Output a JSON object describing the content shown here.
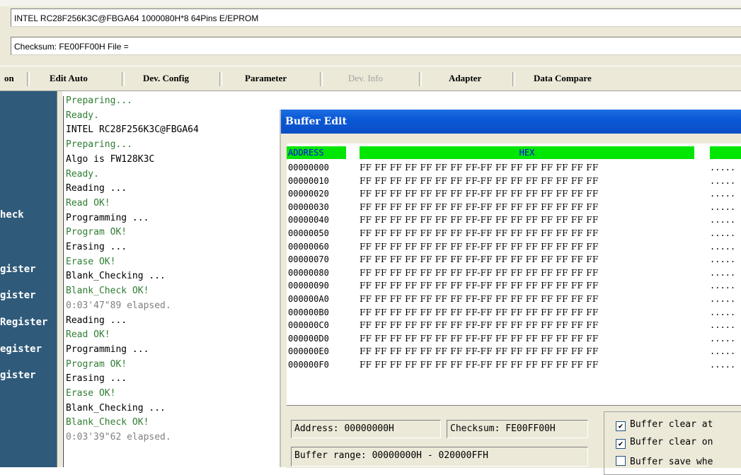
{
  "device_info": "INTEL  RC28F256K3C@FBGA64  1000080H*8  64Pins  E/EPROM",
  "checksum_info": "Checksum: FE00FF00H    File =",
  "menu": {
    "items": [
      {
        "label": "on",
        "disabled": false
      },
      {
        "label": "Edit Auto",
        "disabled": false
      },
      {
        "label": "Dev. Config",
        "disabled": false
      },
      {
        "label": "Parameter",
        "disabled": false
      },
      {
        "label": "Dev. Info",
        "disabled": true
      },
      {
        "label": "Adapter",
        "disabled": false
      },
      {
        "label": "Data Compare",
        "disabled": false
      }
    ]
  },
  "sidebar": {
    "items": [
      "heck",
      "gister",
      "gister",
      "Register",
      "egister",
      "gister"
    ]
  },
  "log": [
    {
      "text": "Preparing...",
      "color": "#2e7d32"
    },
    {
      "text": "Ready.",
      "color": "#2e7d32"
    },
    {
      "text": "INTEL RC28F256K3C@FBGA64",
      "color": "#000000"
    },
    {
      "text": "Preparing...",
      "color": "#2e7d32"
    },
    {
      "text": "Algo is FW128K3C",
      "color": "#000000"
    },
    {
      "text": "Ready.",
      "color": "#2e7d32"
    },
    {
      "text": "Reading ...",
      "color": "#000000"
    },
    {
      "text": "Read OK!",
      "color": "#2e7d32"
    },
    {
      "text": "Programming ...",
      "color": "#000000"
    },
    {
      "text": "Program OK!",
      "color": "#2e7d32"
    },
    {
      "text": "Erasing ...",
      "color": "#000000"
    },
    {
      "text": "Erase OK!",
      "color": "#2e7d32"
    },
    {
      "text": "Blank_Checking ...",
      "color": "#000000"
    },
    {
      "text": "Blank_Check OK!",
      "color": "#2e7d32"
    },
    {
      "text": "0:03'47\"89 elapsed.",
      "color": "#808080"
    },
    {
      "text": "Reading ...",
      "color": "#000000"
    },
    {
      "text": "Read OK!",
      "color": "#2e7d32"
    },
    {
      "text": "Programming ...",
      "color": "#000000"
    },
    {
      "text": "Program OK!",
      "color": "#2e7d32"
    },
    {
      "text": "Erasing ...",
      "color": "#000000"
    },
    {
      "text": "Erase OK!",
      "color": "#2e7d32"
    },
    {
      "text": "Blank_Checking ...",
      "color": "#000000"
    },
    {
      "text": "Blank_Check OK!",
      "color": "#2e7d32"
    },
    {
      "text": "0:03'39\"62 elapsed.",
      "color": "#808080"
    }
  ],
  "buffer_edit": {
    "title": "Buffer Edit",
    "address_header": "ADDRESS",
    "hex_header": "HEX",
    "rows": [
      {
        "addr": "00000000",
        "hex": "FF FF FF FF FF FF FF FF-FF FF FF FF FF FF FF FF",
        "ascii": "....."
      },
      {
        "addr": "00000010",
        "hex": "FF FF FF FF FF FF FF FF-FF FF FF FF FF FF FF FF",
        "ascii": "....."
      },
      {
        "addr": "00000020",
        "hex": "FF FF FF FF FF FF FF FF-FF FF FF FF FF FF FF FF",
        "ascii": "....."
      },
      {
        "addr": "00000030",
        "hex": "FF FF FF FF FF FF FF FF-FF FF FF FF FF FF FF FF",
        "ascii": "....."
      },
      {
        "addr": "00000040",
        "hex": "FF FF FF FF FF FF FF FF-FF FF FF FF FF FF FF FF",
        "ascii": "....."
      },
      {
        "addr": "00000050",
        "hex": "FF FF FF FF FF FF FF FF-FF FF FF FF FF FF FF FF",
        "ascii": "....."
      },
      {
        "addr": "00000060",
        "hex": "FF FF FF FF FF FF FF FF-FF FF FF FF FF FF FF FF",
        "ascii": "....."
      },
      {
        "addr": "00000070",
        "hex": "FF FF FF FF FF FF FF FF-FF FF FF FF FF FF FF FF",
        "ascii": "....."
      },
      {
        "addr": "00000080",
        "hex": "FF FF FF FF FF FF FF FF-FF FF FF FF FF FF FF FF",
        "ascii": "....."
      },
      {
        "addr": "00000090",
        "hex": "FF FF FF FF FF FF FF FF-FF FF FF FF FF FF FF FF",
        "ascii": "....."
      },
      {
        "addr": "000000A0",
        "hex": "FF FF FF FF FF FF FF FF-FF FF FF FF FF FF FF FF",
        "ascii": "....."
      },
      {
        "addr": "000000B0",
        "hex": "FF FF FF FF FF FF FF FF-FF FF FF FF FF FF FF FF",
        "ascii": "....."
      },
      {
        "addr": "000000C0",
        "hex": "FF FF FF FF FF FF FF FF-FF FF FF FF FF FF FF FF",
        "ascii": "....."
      },
      {
        "addr": "000000D0",
        "hex": "FF FF FF FF FF FF FF FF-FF FF FF FF FF FF FF FF",
        "ascii": "....."
      },
      {
        "addr": "000000E0",
        "hex": "FF FF FF FF FF FF FF FF-FF FF FF FF FF FF FF FF",
        "ascii": "....."
      },
      {
        "addr": "000000F0",
        "hex": "FF FF FF FF FF FF FF FF-FF FF FF FF FF FF FF FF",
        "ascii": "....."
      }
    ],
    "address_field": "Address: 00000000H",
    "checksum_field": "Checksum: FE00FF00H",
    "range_field": "Buffer range: 00000000H - 020000FFH",
    "options": [
      {
        "label": "Buffer clear at",
        "checked": true
      },
      {
        "label": "Buffer clear on",
        "checked": true
      },
      {
        "label": "Buffer save whe",
        "checked": false
      }
    ]
  },
  "colors": {
    "header_green": "#00e600",
    "header_text": "#0000ff",
    "sidebar": "#2f5a7a",
    "title_bar": "#0b4fc6"
  }
}
